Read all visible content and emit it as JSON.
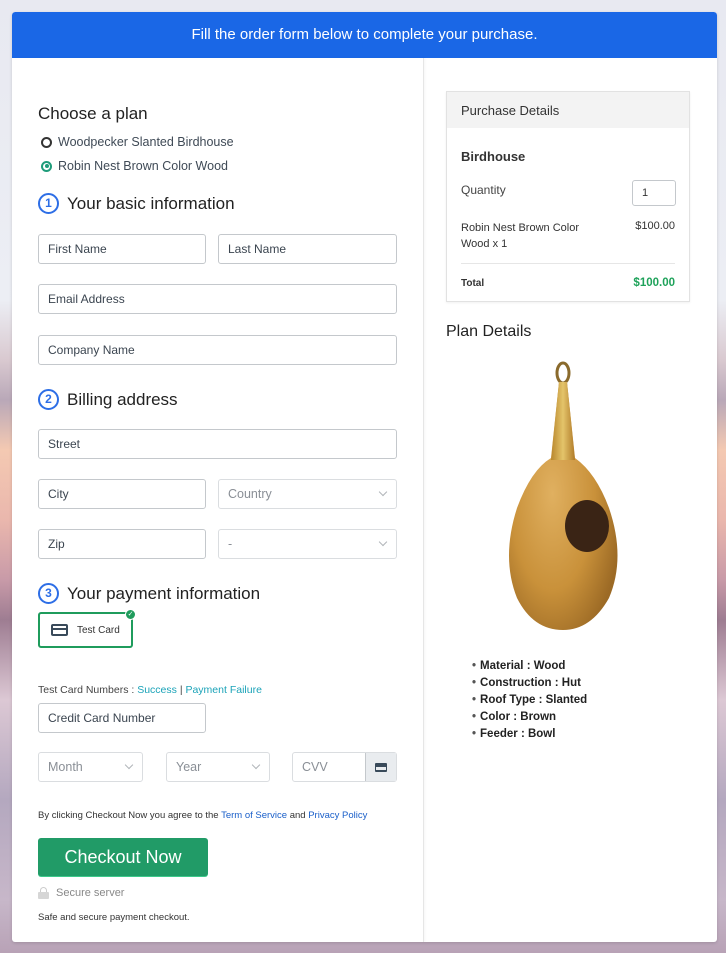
{
  "banner": {
    "text": "Fill the order form below to complete your purchase."
  },
  "plan": {
    "heading": "Choose a plan",
    "options": [
      {
        "label": "Woodpecker Slanted Birdhouse",
        "selected": false
      },
      {
        "label": "Robin Nest Brown Color Wood",
        "selected": true
      }
    ]
  },
  "basic_info": {
    "step": "1",
    "heading": "Your basic information",
    "first_name_placeholder": "First Name",
    "last_name_placeholder": "Last Name",
    "email_placeholder": "Email Address",
    "company_placeholder": "Company Name"
  },
  "billing": {
    "step": "2",
    "heading": "Billing address",
    "street_placeholder": "Street",
    "city_placeholder": "City",
    "country_selected": "Country",
    "zip_placeholder": "Zip",
    "state_selected": "-"
  },
  "payment": {
    "step": "3",
    "heading": "Your payment information",
    "card_option_label": "Test Card",
    "test_numbers_label": "Test Card Numbers :",
    "success_link": "Success",
    "separator": "|",
    "failure_link": "Payment Failure",
    "card_number_placeholder": "Credit Card Number",
    "month_selected": "Month",
    "year_selected": "Year",
    "cvv_placeholder": "CVV"
  },
  "agreement": {
    "prefix": "By clicking Checkout Now you agree to the",
    "terms_link": "Term of Service",
    "and": "and",
    "privacy_link": "Privacy Policy"
  },
  "checkout": {
    "button_label": "Checkout Now",
    "secure_label": "Secure server",
    "safe_note": "Safe and secure payment checkout."
  },
  "purchase_details": {
    "header": "Purchase Details",
    "product_title": "Birdhouse",
    "quantity_label": "Quantity",
    "quantity_value": "1",
    "item_label": "Robin Nest Brown Color Wood x 1",
    "item_price": "$100.00",
    "total_label": "Total",
    "total_value": "$100.00"
  },
  "plan_details": {
    "heading": "Plan Details",
    "features": [
      "Material : Wood",
      "Construction : Hut",
      "Roof Type : Slanted",
      "Color : Brown",
      "Feeder : Bowl"
    ]
  },
  "colors": {
    "banner": "#1a67e6",
    "accent_green": "#219b67",
    "total_green": "#1ea25a",
    "step_blue": "#2d6ee6"
  }
}
